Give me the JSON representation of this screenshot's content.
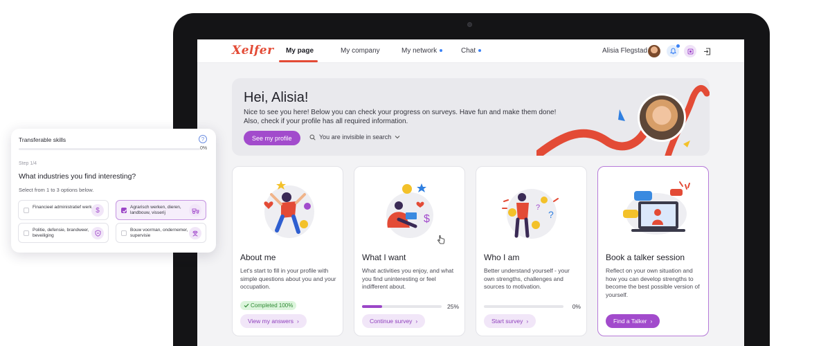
{
  "nav": {
    "logo": "Xelfer",
    "links": [
      {
        "label": "My page",
        "active": true,
        "dot": false
      },
      {
        "label": "My company",
        "active": false,
        "dot": false
      },
      {
        "label": "My network",
        "active": false,
        "dot": true
      },
      {
        "label": "Chat",
        "active": false,
        "dot": true
      }
    ],
    "user_name": "Alisia Flegstad",
    "icons": [
      "bell-icon",
      "notes-icon",
      "logout-icon"
    ]
  },
  "hero": {
    "greeting": "Hei, Alisia!",
    "message": "Nice to see you here! Below you can check your progress on surveys. Have fun and make them done! Also, check if your profile has all required information.",
    "profile_button": "See my profile",
    "visibility": "You are invisible in search"
  },
  "cards": [
    {
      "title": "About me",
      "description": "Let's start to fill in your profile with simple questions about you and your occupation.",
      "status": "Completed 100%",
      "button": "View my answers"
    },
    {
      "title": "What I want",
      "description": "What activities you enjoy, and what you find uninteresting or feel indifferent about.",
      "progress": 0.25,
      "progress_label": "25%",
      "button": "Continue survey"
    },
    {
      "title": "Who I am",
      "description": "Better understand yourself - your own strengths, challenges and sources to motivation.",
      "progress": 0,
      "progress_label": "0%",
      "button": "Start survey"
    },
    {
      "title": "Book a talker session",
      "description": "Reflect on your own situation and how you can develop strengths to become the best possible version of yourself.",
      "button": "Find a Talker"
    }
  ],
  "survey_panel": {
    "title": "Transferable skills",
    "progress": 0,
    "progress_label": "0%",
    "step": "Step 1/4",
    "question": "What industries you find interesting?",
    "hint": "Select from 1 to 3 options below.",
    "options": [
      {
        "label": "Financieel administratief werk",
        "selected": false,
        "icon": "dollar-icon"
      },
      {
        "label": "Agrarisch werken, dieren, landbouw, visserij",
        "selected": true,
        "icon": "tractor-icon"
      },
      {
        "label": "Politie, defensie, brandweer, beveiliging",
        "selected": false,
        "icon": "shield-icon"
      },
      {
        "label": "Bouw voorman, ondernemer, supervisie",
        "selected": false,
        "icon": "worker-icon"
      }
    ]
  },
  "colors": {
    "brand": "#e34b36",
    "accent": "#a24bcc",
    "success": "#2f8a34",
    "info": "#3b82f6"
  }
}
